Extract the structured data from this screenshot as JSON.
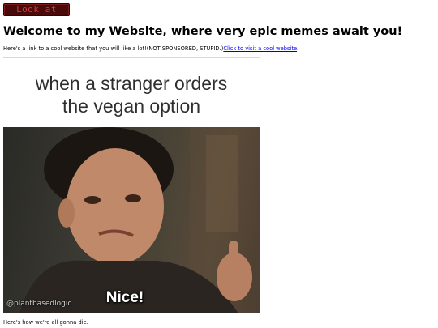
{
  "header": {
    "button_label": "Look at"
  },
  "main": {
    "title": "Welcome to my Website, where very epic memes await you!",
    "intro_text": "Here's a link to a cool website that you will like a lot!(NOT SPONSORED, STUPID.)",
    "link_text": "Click to visit a cool website",
    "link_suffix": "."
  },
  "meme": {
    "caption_line_1": "when a stranger orders",
    "caption_line_2": "the vegan option",
    "overlay_text": "Nice!",
    "watermark": "@plantbasedlogic"
  },
  "footer": {
    "text": "Here's how we're all gonna die."
  },
  "colors": {
    "button_bg": "#4a0a0a",
    "button_text": "#d23a3a",
    "link": "#0000ee"
  }
}
